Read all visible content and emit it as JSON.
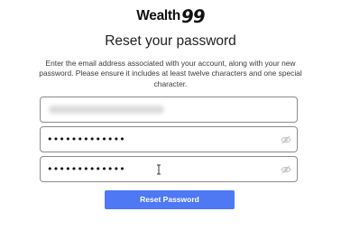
{
  "brand": {
    "word": "Wealth",
    "number": "99"
  },
  "title": "Reset your password",
  "description": "Enter the email address associated with your account, along with your new password. Please ensure it includes at least twelve characters and one special character.",
  "form": {
    "password_mask": "•••••••••••••",
    "confirm_password_mask": "•••••••••••••",
    "show_password_icon": "eye-icon"
  },
  "submit_label": "Reset Password",
  "colors": {
    "button": "#4f78f4",
    "field_border": "#8a8a8a"
  }
}
